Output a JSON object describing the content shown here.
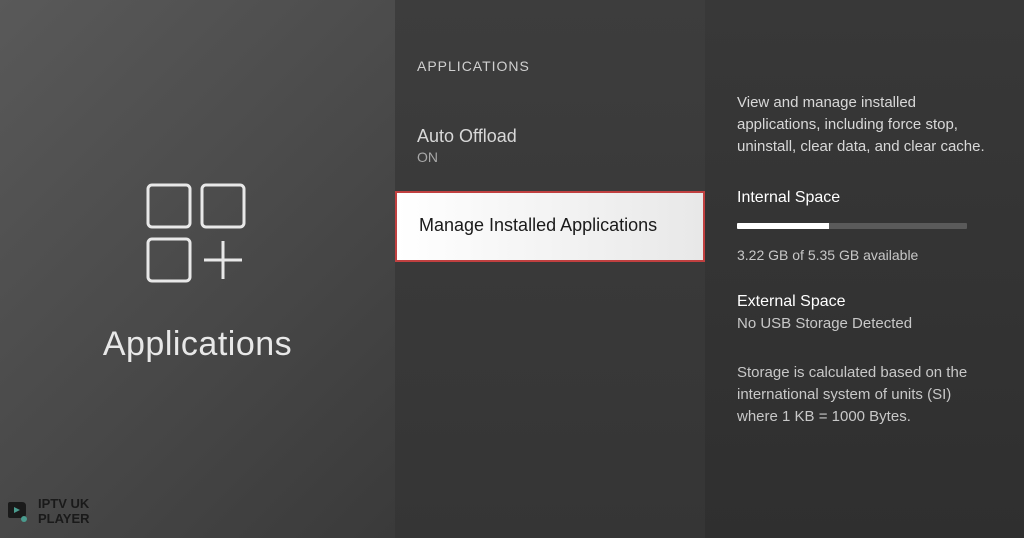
{
  "left": {
    "title": "Applications"
  },
  "middle": {
    "header": "APPLICATIONS",
    "items": [
      {
        "title": "Auto Offload",
        "subtitle": "ON"
      },
      {
        "title": "Manage Installed Applications"
      }
    ]
  },
  "right": {
    "description": "View and manage installed applications, including force stop, uninstall, clear data, and clear cache.",
    "internal_label": "Internal Space",
    "internal_value": "3.22 GB of 5.35 GB available",
    "internal_percent": 40,
    "external_label": "External Space",
    "external_value": "No USB Storage Detected",
    "storage_note": "Storage is calculated based on the international system of units (SI) where 1 KB = 1000 Bytes."
  },
  "watermark": {
    "line1": "IPTV UK",
    "line2": "PLAYER"
  }
}
